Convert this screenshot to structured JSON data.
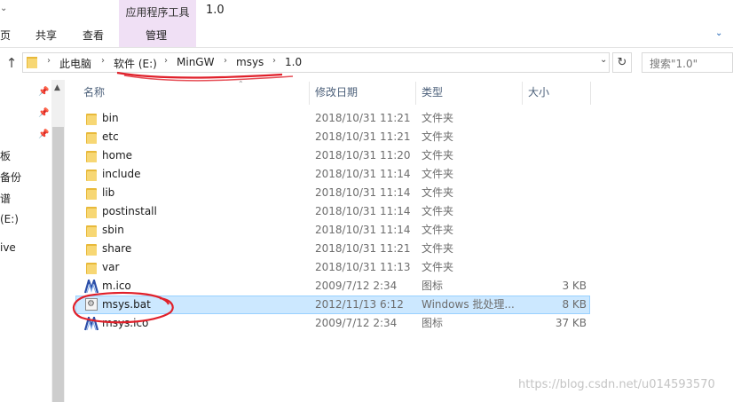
{
  "window": {
    "title": "1.0"
  },
  "ribbon": {
    "context_group": "应用程序工具",
    "tabs": [
      "页",
      "共享",
      "查看",
      "管理"
    ]
  },
  "address": {
    "crumbs": [
      "此电脑",
      "软件 (E:)",
      "MinGW",
      "msys",
      "1.0"
    ],
    "search_placeholder": "搜索\"1.0\""
  },
  "nav_pane": {
    "items": [
      "板",
      "备份",
      "谱",
      "(E:)",
      "ive"
    ]
  },
  "columns": {
    "name": "名称",
    "date": "修改日期",
    "type": "类型",
    "size": "大小"
  },
  "files": [
    {
      "name": "bin",
      "date": "2018/10/31 11:21",
      "type": "文件夹",
      "size": "",
      "icon": "folder-icon"
    },
    {
      "name": "etc",
      "date": "2018/10/31 11:21",
      "type": "文件夹",
      "size": "",
      "icon": "folder-icon"
    },
    {
      "name": "home",
      "date": "2018/10/31 11:20",
      "type": "文件夹",
      "size": "",
      "icon": "folder-icon"
    },
    {
      "name": "include",
      "date": "2018/10/31 11:14",
      "type": "文件夹",
      "size": "",
      "icon": "folder-icon"
    },
    {
      "name": "lib",
      "date": "2018/10/31 11:14",
      "type": "文件夹",
      "size": "",
      "icon": "folder-icon"
    },
    {
      "name": "postinstall",
      "date": "2018/10/31 11:14",
      "type": "文件夹",
      "size": "",
      "icon": "folder-icon"
    },
    {
      "name": "sbin",
      "date": "2018/10/31 11:14",
      "type": "文件夹",
      "size": "",
      "icon": "folder-icon"
    },
    {
      "name": "share",
      "date": "2018/10/31 11:21",
      "type": "文件夹",
      "size": "",
      "icon": "folder-icon"
    },
    {
      "name": "var",
      "date": "2018/10/31 11:13",
      "type": "文件夹",
      "size": "",
      "icon": "folder-icon"
    },
    {
      "name": "m.ico",
      "date": "2009/7/12 2:34",
      "type": "图标",
      "size": "3 KB",
      "icon": "msys-ico-icon"
    },
    {
      "name": "msys.bat",
      "date": "2012/11/13 6:12",
      "type": "Windows 批处理...",
      "size": "8 KB",
      "icon": "batch-file-icon",
      "selected": true
    },
    {
      "name": "msys.ico",
      "date": "2009/7/12 2:34",
      "type": "图标",
      "size": "37 KB",
      "icon": "msys-ico-icon"
    }
  ],
  "watermark": "https://blog.csdn.net/u014593570",
  "colors": {
    "selection": "#cce8ff",
    "context_tab": "#f0e0f5",
    "annotation": "#e0202a"
  }
}
